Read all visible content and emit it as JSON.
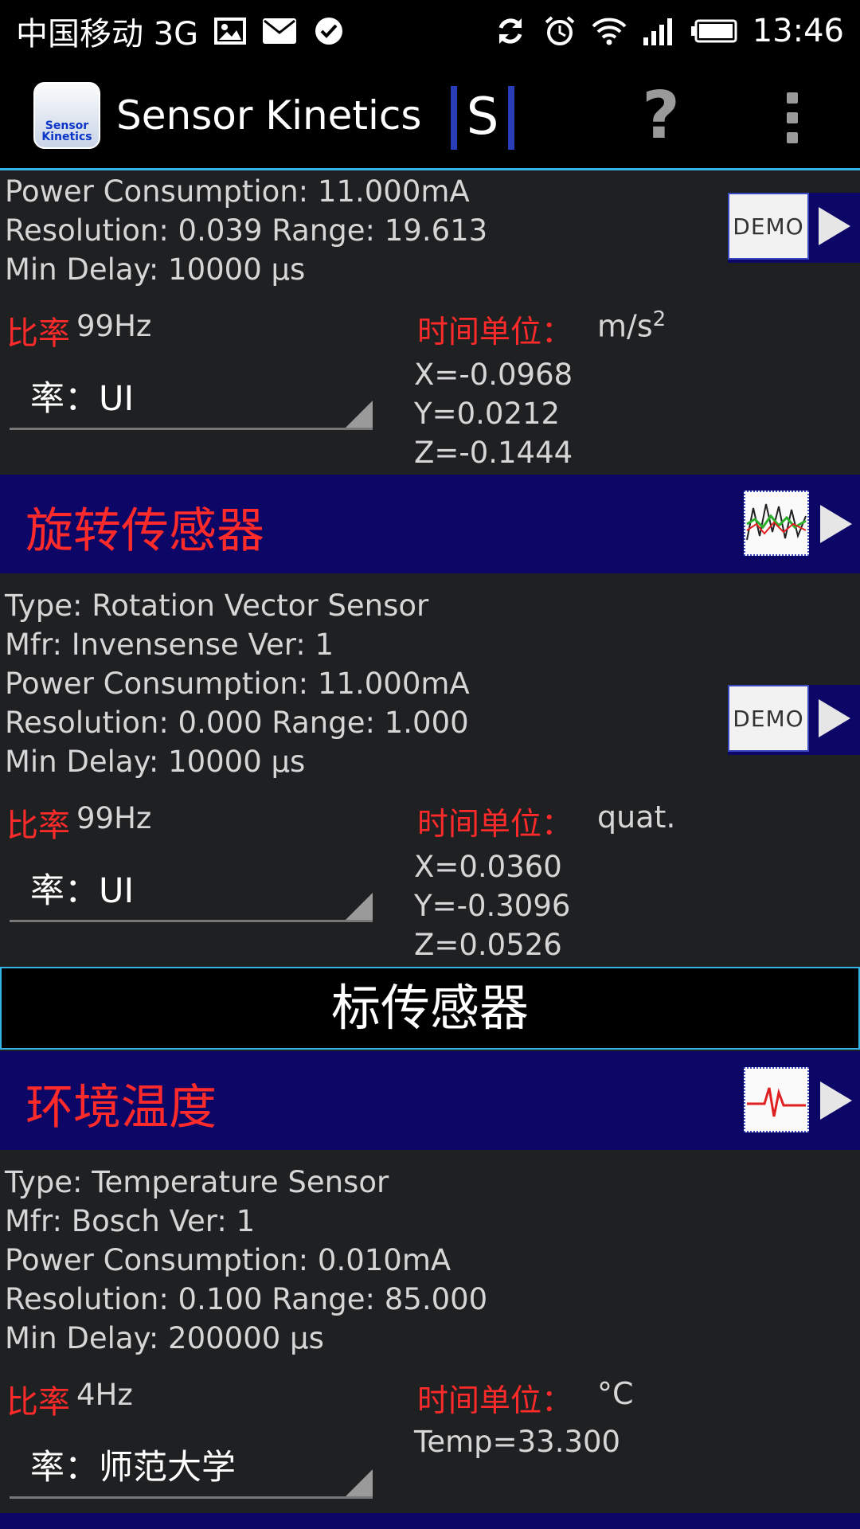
{
  "status_bar": {
    "carrier": "中国移动 3G",
    "time": "13:46"
  },
  "app": {
    "title": "Sensor Kinetics",
    "logo_text": "Sensor Kinetics",
    "s_logo": "S",
    "help": "?"
  },
  "sensors": [
    {
      "info": [
        "Power Consumption: 11.000mA",
        "Resolution: 0.039 Range: 19.613",
        "Min Delay: 10000 µs"
      ],
      "demo_label": "DEMO",
      "rate_label": "比率",
      "rate_value": "99Hz",
      "unit_label": "时间单位：",
      "unit_value": "m/s",
      "unit_sup": "2",
      "spinner": "率：UI",
      "values": [
        "X=-0.0968",
        "Y=0.0212",
        "Z=-0.1444"
      ]
    },
    {
      "title": "旋转传感器",
      "info": [
        "Type: Rotation Vector Sensor",
        "Mfr: Invensense  Ver: 1",
        "Power Consumption: 11.000mA",
        "Resolution: 0.000 Range: 1.000",
        "Min Delay: 10000 µs"
      ],
      "demo_label": "DEMO",
      "rate_label": "比率",
      "rate_value": "99Hz",
      "unit_label": "时间单位：",
      "unit_value": "quat.",
      "spinner": "率：UI",
      "values": [
        "X=0.0360",
        "Y=-0.3096",
        "Z=0.0526"
      ]
    },
    {
      "title": "环境温度",
      "info": [
        "Type: Temperature Sensor",
        "Mfr: Bosch  Ver: 1",
        "Power Consumption: 0.010mA",
        "Resolution: 0.100 Range: 85.000",
        "Min Delay: 200000 µs"
      ],
      "rate_label": "比率",
      "rate_value": "4Hz",
      "unit_label": "时间单位：",
      "unit_value": "°C",
      "spinner": "率：师范大学",
      "values": [
        "Temp=33.300"
      ]
    }
  ],
  "section_header": "标传感器",
  "colors": {
    "header_bg": "#0c0666",
    "accent": "#33b5e5",
    "label_red": "#ff2a2a"
  }
}
